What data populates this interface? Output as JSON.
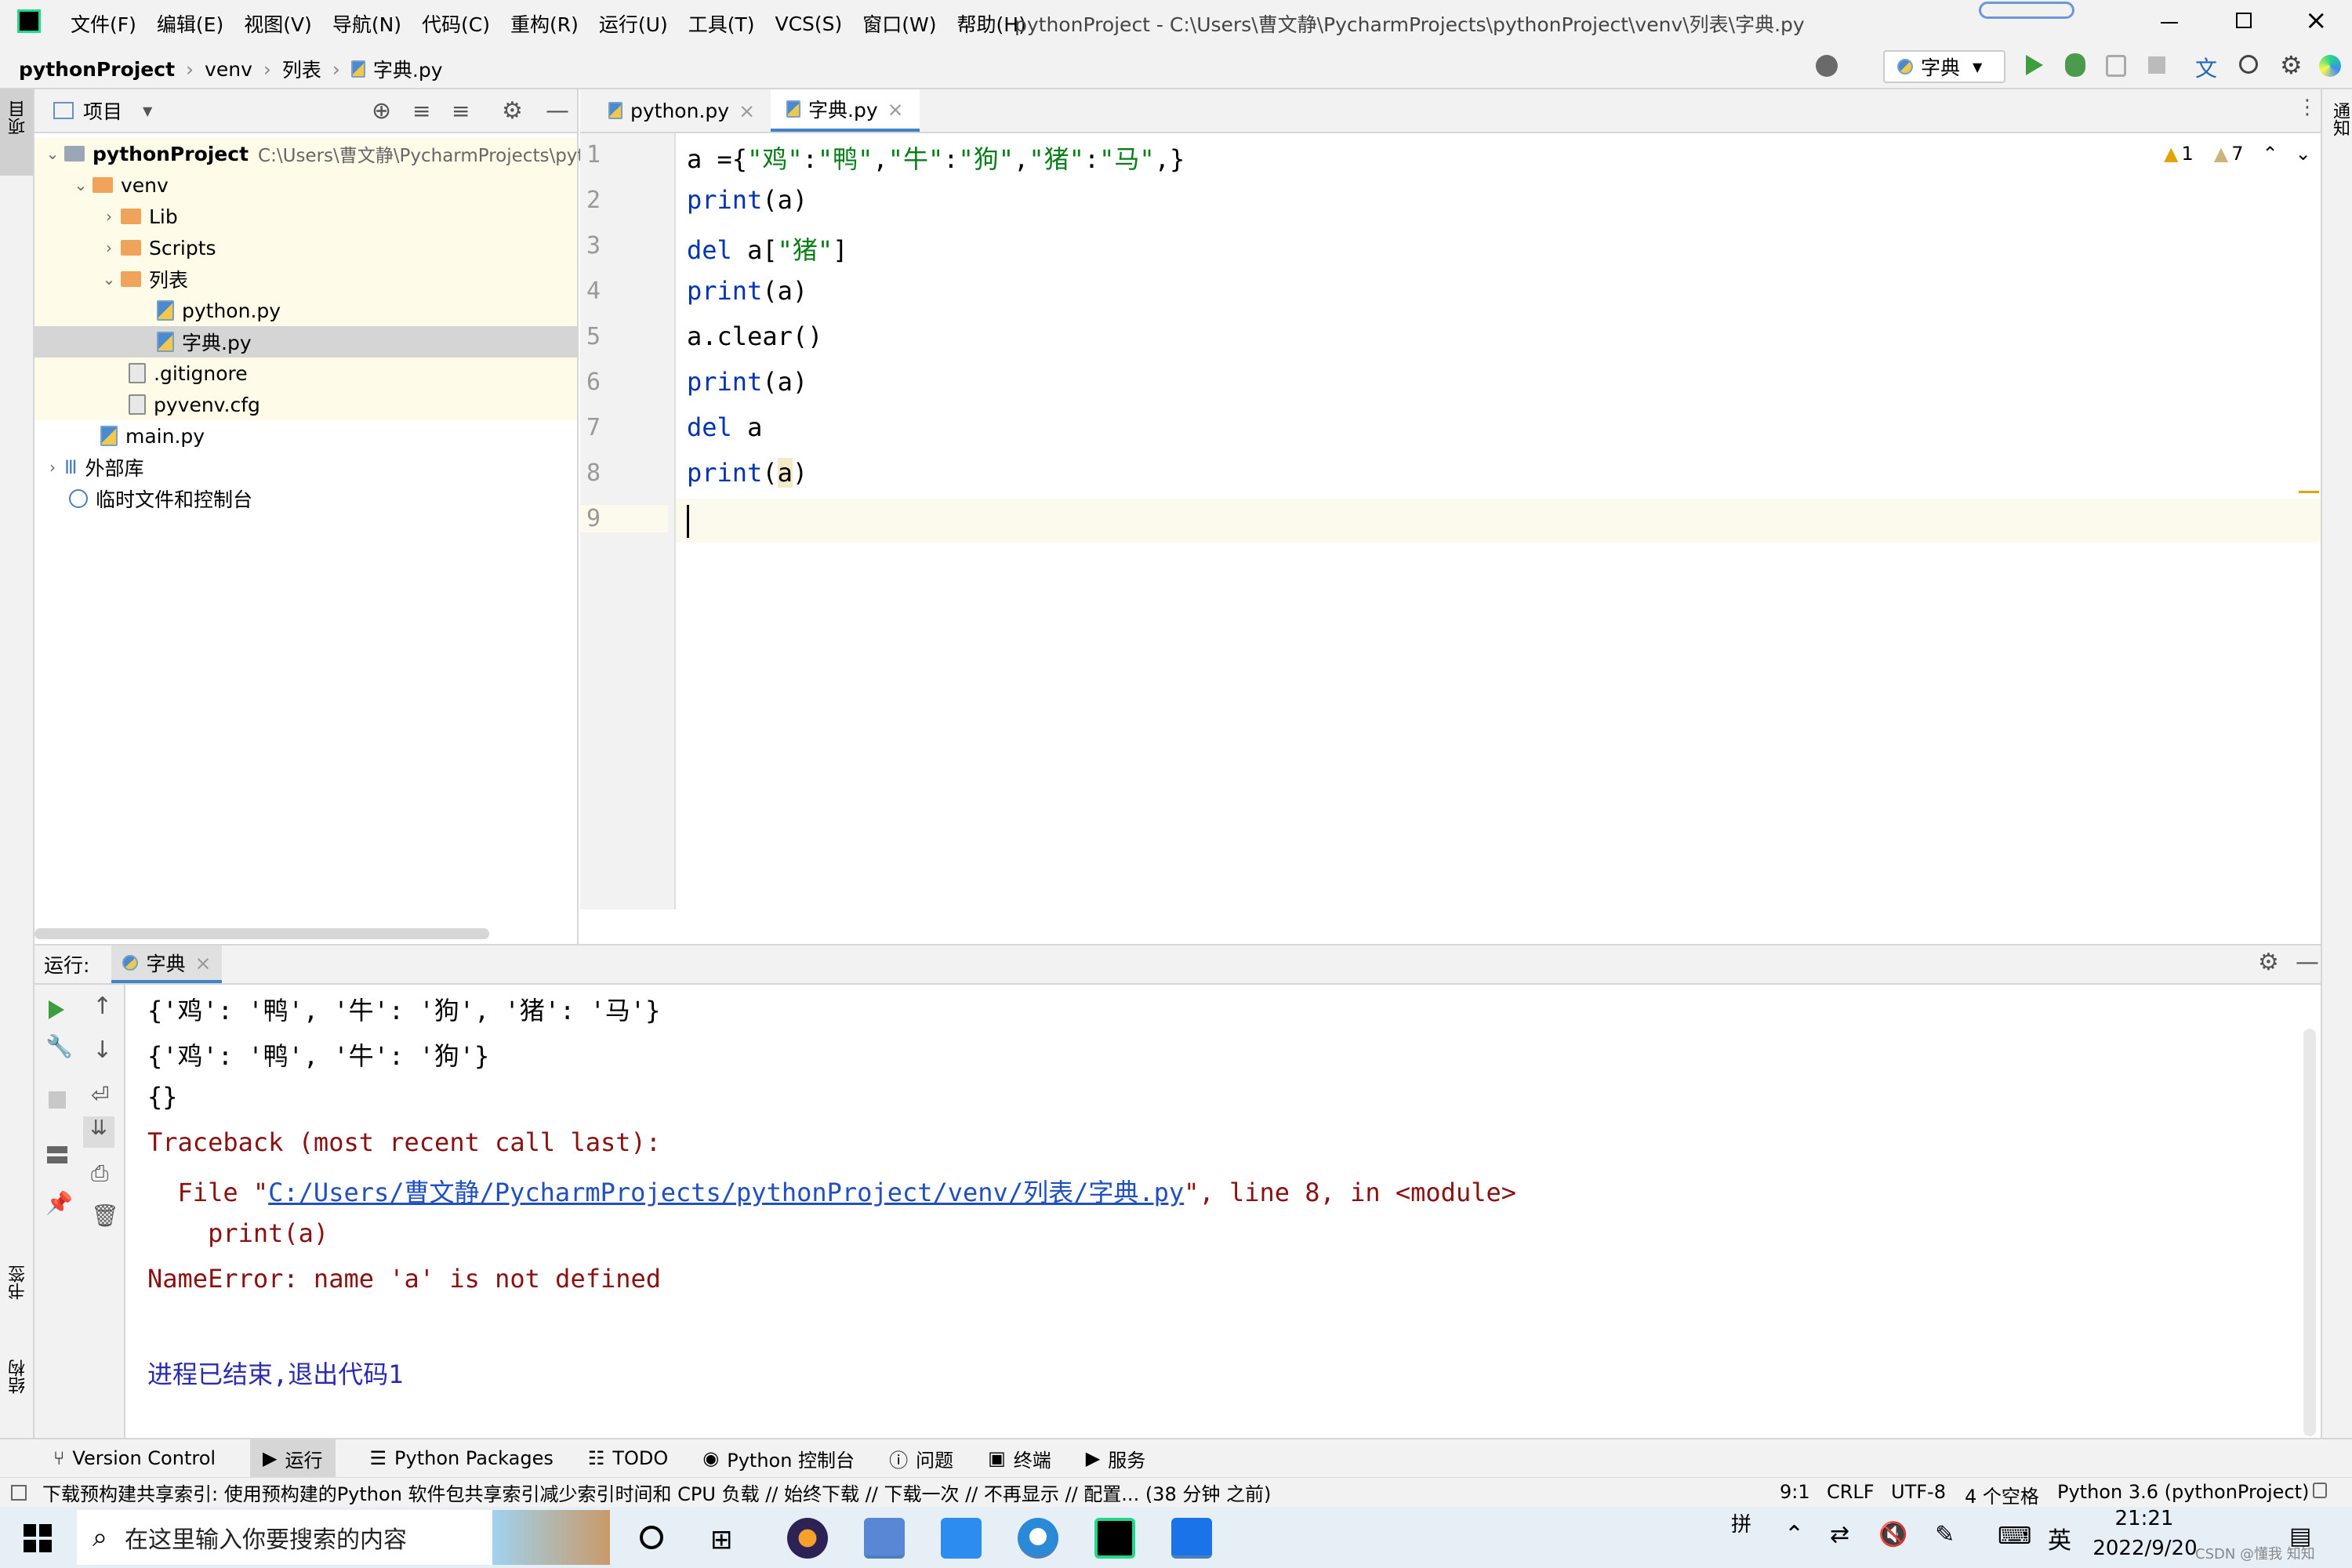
{
  "window": {
    "menu": [
      "文件(F)",
      "编辑(E)",
      "视图(V)",
      "导航(N)",
      "代码(C)",
      "重构(R)",
      "运行(U)",
      "工具(T)",
      "VCS(S)",
      "窗口(W)",
      "帮助(H)"
    ],
    "title": "pythonProject - C:\\Users\\曹文静\\PycharmProjects\\pythonProject\\venv\\列表\\字典.py"
  },
  "breadcrumb": [
    "pythonProject",
    "venv",
    "列表",
    "字典.py"
  ],
  "run_config": "字典",
  "project_panel": {
    "title": "项目",
    "root_name": "pythonProject",
    "root_path": "C:\\Users\\曹文静\\PycharmProjects\\pyt",
    "items": [
      "venv",
      "Lib",
      "Scripts",
      "列表",
      "python.py",
      "字典.py",
      ".gitignore",
      "pyvenv.cfg",
      "main.py",
      "外部库",
      "临时文件和控制台"
    ]
  },
  "editor": {
    "tabs": [
      "python.py",
      "字典.py"
    ],
    "line_numbers": [
      "1",
      "2",
      "3",
      "4",
      "5",
      "6",
      "7",
      "8",
      "9"
    ],
    "warnings": "1",
    "weak_warnings": "7"
  },
  "run_panel": {
    "label": "运行:",
    "tab": "字典",
    "output": [
      "{'鸡': '鸭', '牛': '狗', '猪': '马'}",
      "{'鸡': '鸭', '牛': '狗'}",
      "{}",
      "Traceback (most recent call last):",
      "  File \"",
      "C:/Users/曹文静/PycharmProjects/pythonProject/venv/列表/字典.py",
      "\", line 8, in <module>",
      "    print(a)",
      "NameError: name 'a' is not defined",
      "进程已结束,退出代码1"
    ]
  },
  "tool_tabs": [
    "Version Control",
    "运行",
    "Python Packages",
    "TODO",
    "Python 控制台",
    "问题",
    "终端",
    "服务"
  ],
  "status_bar": {
    "message": "下载预构建共享索引: 使用预构建的Python 软件包共享索引减少索引时间和 CPU 负载 // 始终下载 // 下载一次 // 不再显示 // 配置... (38 分钟 之前)",
    "position": "9:1",
    "line_sep": "CRLF",
    "encoding": "UTF-8",
    "indent": "4 个空格",
    "interpreter": "Python 3.6 (pythonProject)"
  },
  "side_labels": {
    "project": "项目",
    "bookmarks": "书签",
    "structure": "结构",
    "notifications": "通知"
  },
  "taskbar": {
    "search_placeholder": "在这里输入你要搜索的内容",
    "ime": "拼",
    "lang": "英",
    "time": "21:21",
    "date": "2022/9/20",
    "watermark": "CSDN @懂我 知知"
  }
}
